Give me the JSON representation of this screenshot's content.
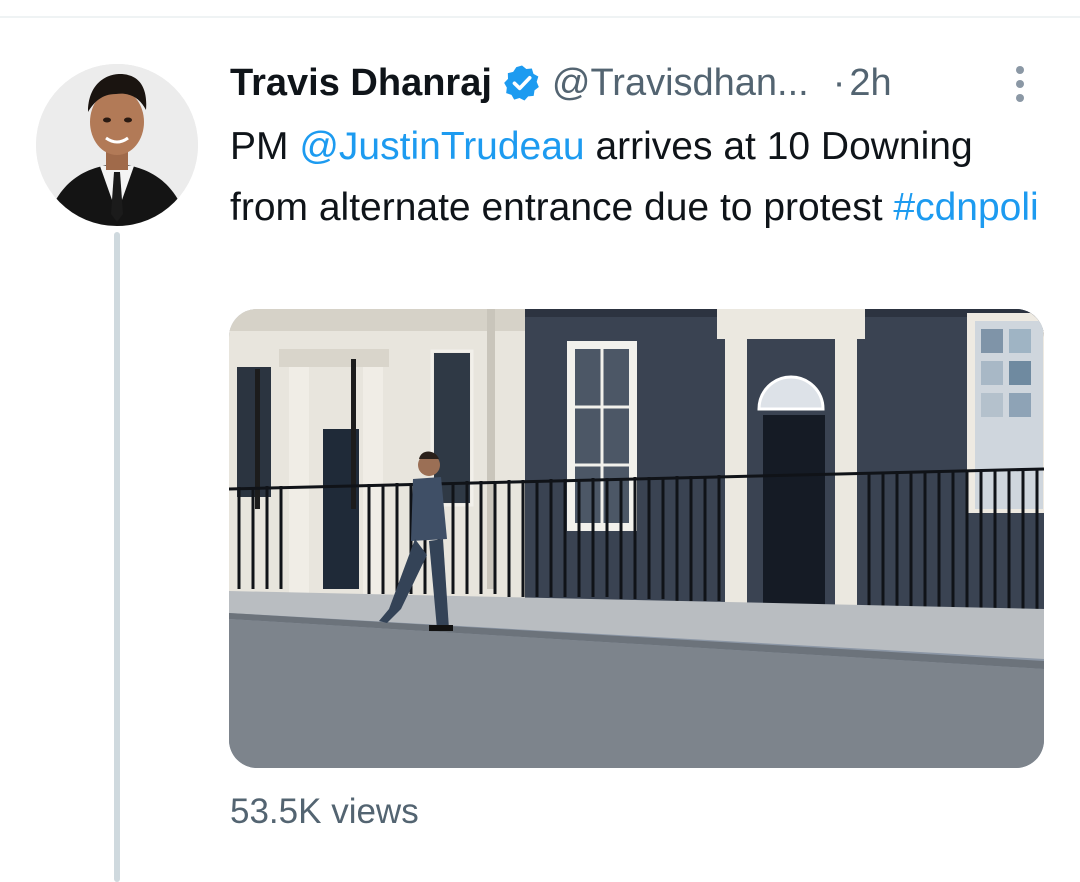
{
  "author": {
    "display_name": "Travis Dhanraj",
    "handle": "@Travisdhan...",
    "time": "2h",
    "separator": "·"
  },
  "tweet": {
    "text_prefix": "PM ",
    "mention": "@JustinTrudeau",
    "text_middle": " arrives at 10 Downing from alternate entrance due to protest ",
    "hashtag": "#cdnpoli"
  },
  "stats": {
    "views": "53.5K views"
  },
  "colors": {
    "link": "#1d9bf0",
    "secondary_text": "#536471",
    "verified": "#1d9bf0"
  },
  "icons": {
    "verified": "verified-badge-icon",
    "more": "more-options-icon"
  }
}
